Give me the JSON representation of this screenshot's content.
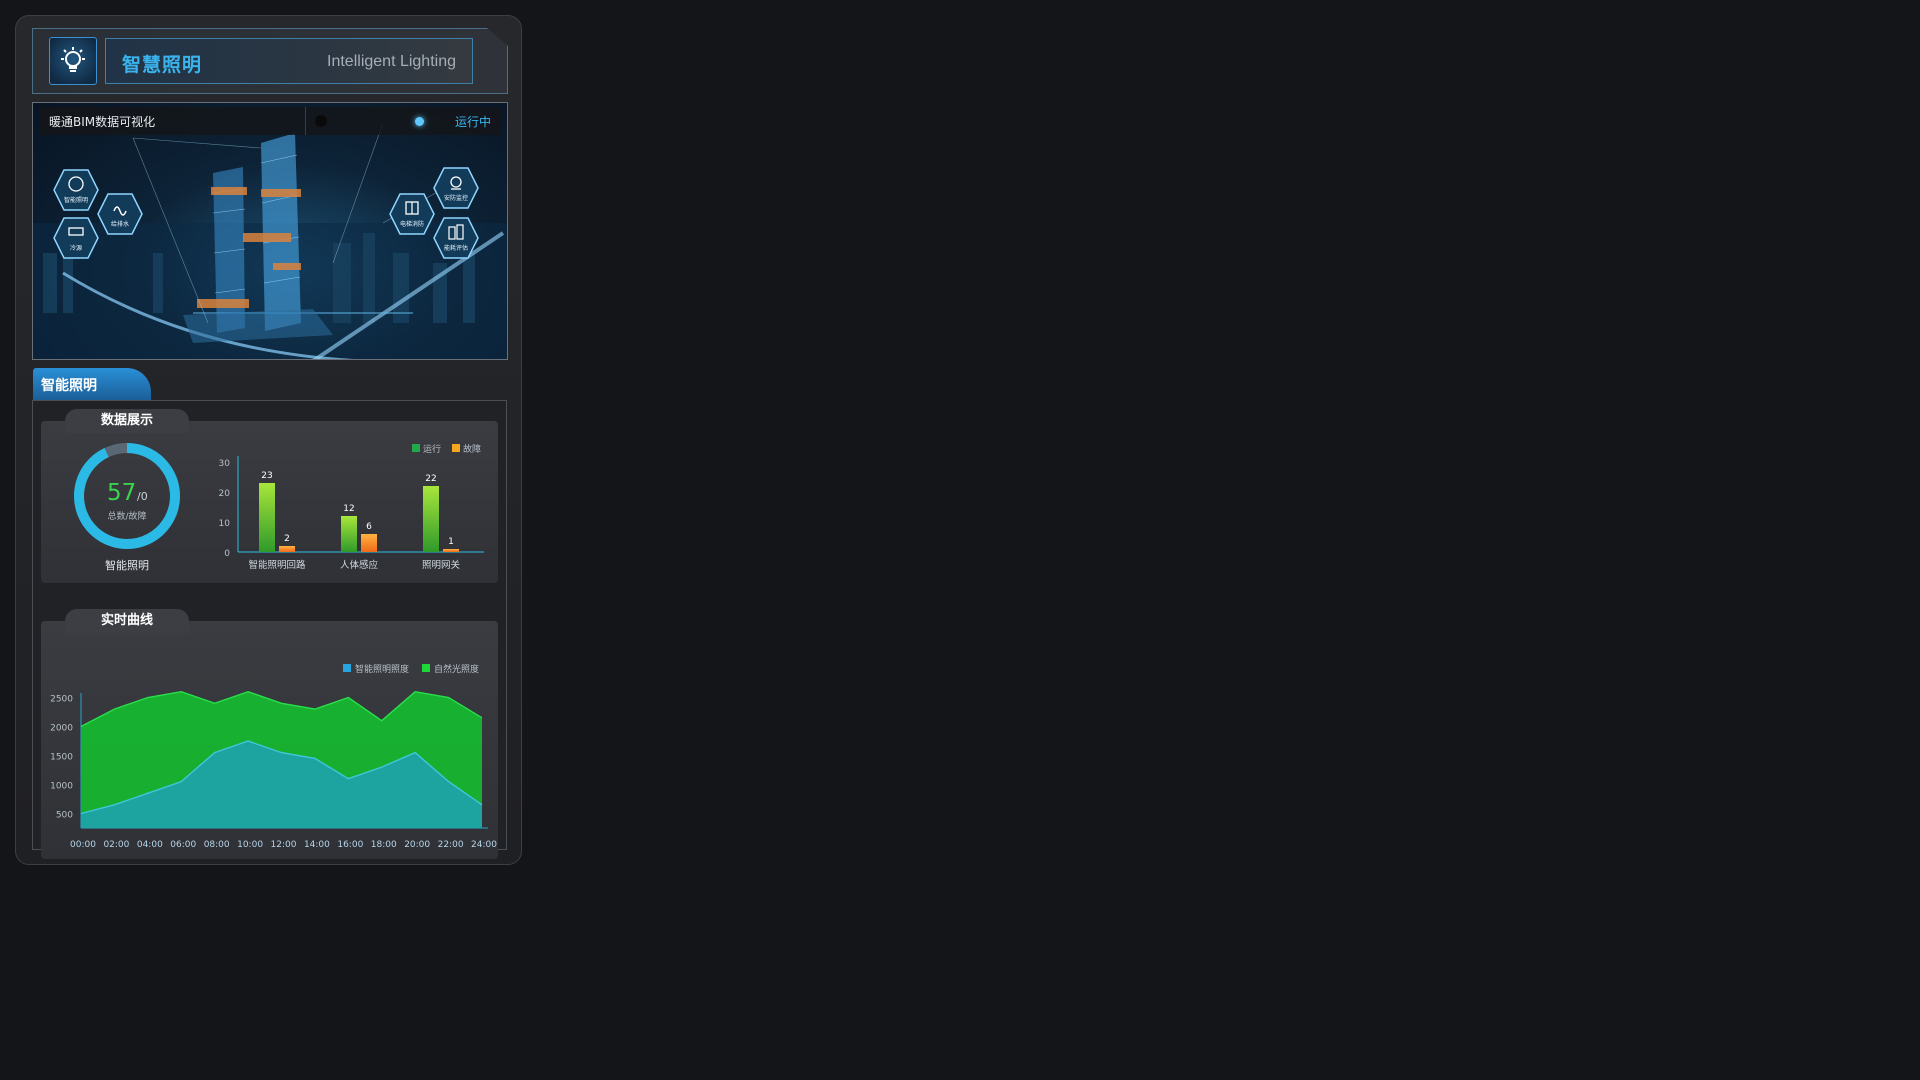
{
  "header": {
    "title": "智慧照明",
    "subtitle": "Intelligent Lighting",
    "icon": "lightbulb-icon"
  },
  "bim": {
    "title": "暖通BIM数据可视化",
    "status": "运行中",
    "hex_labels": [
      "智能照明",
      "给排水",
      "冷源",
      "电梯消防",
      "安防监控",
      "能耗评估"
    ]
  },
  "section": {
    "title": "智能照明"
  },
  "data_card": {
    "title": "数据展示",
    "gauge": {
      "total": "57",
      "fault": "/0",
      "caption": "总数/故障",
      "label": "智能照明",
      "fraction": 0.93
    },
    "legend": [
      "运行",
      "故障"
    ]
  },
  "curve_card": {
    "title": "实时曲线",
    "legend": [
      "智能照明照度",
      "自然光照度"
    ]
  },
  "colors": {
    "accent": "#3ab4ee",
    "run": "#22a94a",
    "fault": "#f5a623",
    "curve_green": "#17b62f",
    "curve_teal": "#1fa3a7"
  },
  "chart_data": [
    {
      "type": "bar",
      "categories": [
        "智能照明回路",
        "人体感应",
        "照明网关"
      ],
      "series": [
        {
          "name": "运行",
          "values": [
            23,
            12,
            22
          ]
        },
        {
          "name": "故障",
          "values": [
            2,
            6,
            1
          ]
        }
      ],
      "yticks": [
        0,
        10,
        20,
        30
      ],
      "ylim": [
        0,
        30
      ],
      "legend_position": "top-right"
    },
    {
      "type": "area",
      "x": [
        "00:00",
        "02:00",
        "04:00",
        "06:00",
        "08:00",
        "10:00",
        "12:00",
        "14:00",
        "16:00",
        "18:00",
        "20:00",
        "22:00",
        "24:00"
      ],
      "series": [
        {
          "name": "智能照明照度",
          "values": [
            500,
            650,
            850,
            1050,
            1550,
            1750,
            1550,
            1450,
            1100,
            1300,
            1550,
            1050,
            650
          ]
        },
        {
          "name": "自然光照度",
          "values": [
            2000,
            2300,
            2500,
            2600,
            2400,
            2600,
            2400,
            2300,
            2500,
            2100,
            2600,
            2500,
            2150
          ]
        }
      ],
      "yticks": [
        500,
        1000,
        1500,
        2000,
        2500
      ],
      "ylim": [
        250,
        2750
      ],
      "legend_position": "top-right"
    }
  ]
}
